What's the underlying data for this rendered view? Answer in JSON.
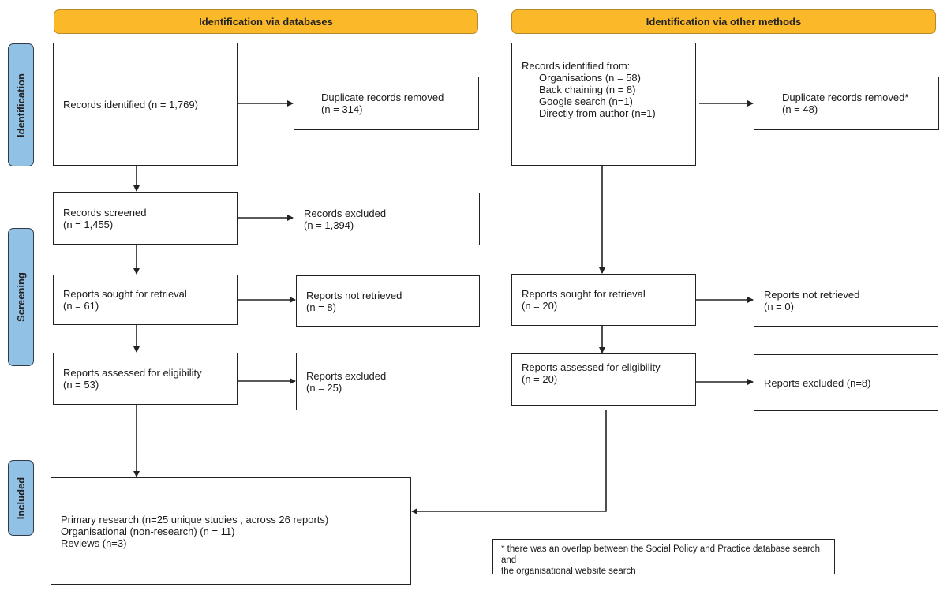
{
  "headers": {
    "databases": "Identification via databases",
    "other_methods": "Identification via other methods"
  },
  "phases": {
    "identification": "Identification",
    "screening": "Screening",
    "included": "Included"
  },
  "databases": {
    "records_identified": "Records identified (n = 1,769)",
    "duplicates_removed": [
      "Duplicate records removed",
      "(n = 314)"
    ],
    "records_screened": [
      "Records screened",
      "(n = 1,455)"
    ],
    "records_excluded": [
      "Records excluded",
      "(n = 1,394)"
    ],
    "reports_sought": [
      "Reports sought for retrieval",
      "(n = 61)"
    ],
    "reports_not_retrieved": [
      "Reports not retrieved",
      "(n = 8)"
    ],
    "reports_assessed": [
      "Reports assessed for eligibility",
      "(n = 53)"
    ],
    "reports_excluded": [
      "Reports excluded",
      "(n = 25)"
    ]
  },
  "other_methods": {
    "records_identified_title": "Records identified from:",
    "records_identified_items": [
      "Organisations (n = 58)",
      "Back chaining (n = 8)",
      "Google search (n=1)",
      "Directly from author (n=1)"
    ],
    "duplicates_removed": [
      "Duplicate records removed*",
      "(n = 48)"
    ],
    "reports_sought": [
      "Reports sought for retrieval",
      "(n = 20)"
    ],
    "reports_not_retrieved": [
      "Reports not retrieved",
      "(n = 0)"
    ],
    "reports_assessed": [
      "Reports assessed for eligibility",
      "(n = 20)"
    ],
    "reports_excluded": "Reports excluded (n=8)"
  },
  "included": [
    "Primary research (n=25 unique studies , across 26 reports)",
    "Organisational (non-research) (n = 11)",
    "Reviews (n=3)"
  ],
  "footnote": [
    "* there was an overlap between the  Social Policy and Practice database search and",
    "the organisational website search"
  ],
  "colors": {
    "header_fill": "#fbb829",
    "phase_fill": "#92c1e6",
    "line": "#222222"
  }
}
